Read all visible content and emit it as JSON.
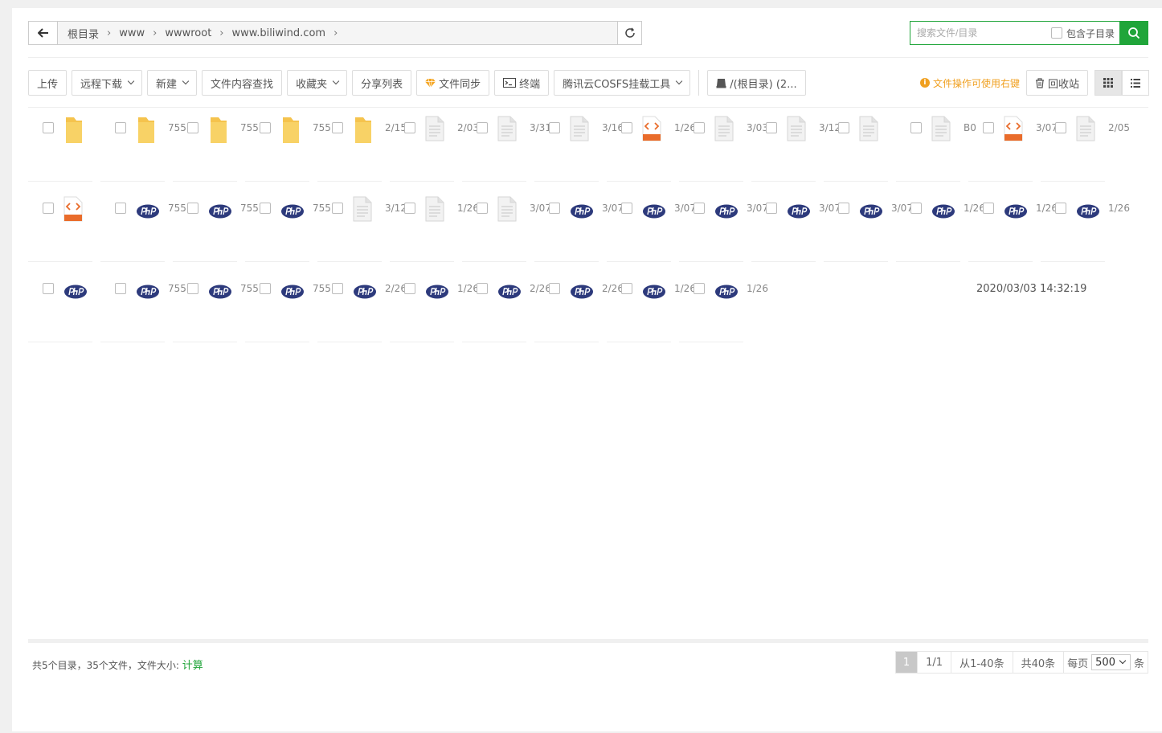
{
  "breadcrumb": {
    "items": [
      "根目录",
      "www",
      "wwwroot",
      "www.biliwind.com"
    ]
  },
  "search": {
    "placeholder": "搜索文件/目录",
    "include_subdir": "包含子目录"
  },
  "toolbar": {
    "upload": "上传",
    "remote_download": "远程下载",
    "new": "新建",
    "content_search": "文件内容查找",
    "favorites": "收藏夹",
    "share_list": "分享列表",
    "file_sync": "文件同步",
    "terminal": "终端",
    "cosfs": "腾讯云COSFS挂载工具",
    "disk": "/(根目录) (2...",
    "right_click_tip": "文件操作可使用右键",
    "recycle": "回收站"
  },
  "files": [
    {
      "type": "folder",
      "info": ""
    },
    {
      "type": "folder",
      "info": "755"
    },
    {
      "type": "folder",
      "info": "755"
    },
    {
      "type": "folder",
      "info": "755"
    },
    {
      "type": "folder",
      "info": "2/15"
    },
    {
      "type": "file",
      "info": "2/03"
    },
    {
      "type": "file",
      "info": "3/31"
    },
    {
      "type": "file",
      "info": "3/16"
    },
    {
      "type": "html",
      "info": "1/26"
    },
    {
      "type": "file",
      "info": "3/03"
    },
    {
      "type": "file",
      "info": "3/12"
    },
    {
      "type": "file",
      "info": ""
    },
    {
      "type": "file",
      "info": "B0"
    },
    {
      "type": "html",
      "info": "3/07"
    },
    {
      "type": "file",
      "info": "2/05"
    },
    {
      "type": "html",
      "info": ""
    },
    {
      "type": "php",
      "info": "755"
    },
    {
      "type": "php",
      "info": "755"
    },
    {
      "type": "php",
      "info": "755"
    },
    {
      "type": "file",
      "info": "3/12"
    },
    {
      "type": "file",
      "info": "1/26"
    },
    {
      "type": "file",
      "info": "3/07"
    },
    {
      "type": "php",
      "info": "3/07"
    },
    {
      "type": "php",
      "info": "3/07"
    },
    {
      "type": "php",
      "info": "3/07"
    },
    {
      "type": "php",
      "info": "3/07"
    },
    {
      "type": "php",
      "info": "3/07"
    },
    {
      "type": "php",
      "info": "1/26"
    },
    {
      "type": "php",
      "info": "1/26"
    },
    {
      "type": "php",
      "info": "1/26"
    },
    {
      "type": "php",
      "info": ""
    },
    {
      "type": "php",
      "info": "755"
    },
    {
      "type": "php",
      "info": "755"
    },
    {
      "type": "php",
      "info": "755"
    },
    {
      "type": "php",
      "info": "2/26"
    },
    {
      "type": "php",
      "info": "1/26"
    },
    {
      "type": "php",
      "info": "2/26"
    },
    {
      "type": "php",
      "info": "2/26"
    },
    {
      "type": "php",
      "info": "1/26"
    },
    {
      "type": "php",
      "info": "1/26"
    }
  ],
  "overflow_text": "2020/03/03 14:32:19",
  "footer": {
    "summary": "共5个目录，35个文件，文件大小:",
    "calc": "计算",
    "page_current": "1",
    "page_total": "1/1",
    "range": "从1-40条",
    "total": "共40条",
    "per_page_label": "每页",
    "per_page_value": "500",
    "per_page_unit": "条"
  },
  "colors": {
    "accent": "#20a53a",
    "tip": "#f0a020",
    "php": "#2d3a7c",
    "html": "#e96c2b",
    "folder": "#f5c34d"
  }
}
